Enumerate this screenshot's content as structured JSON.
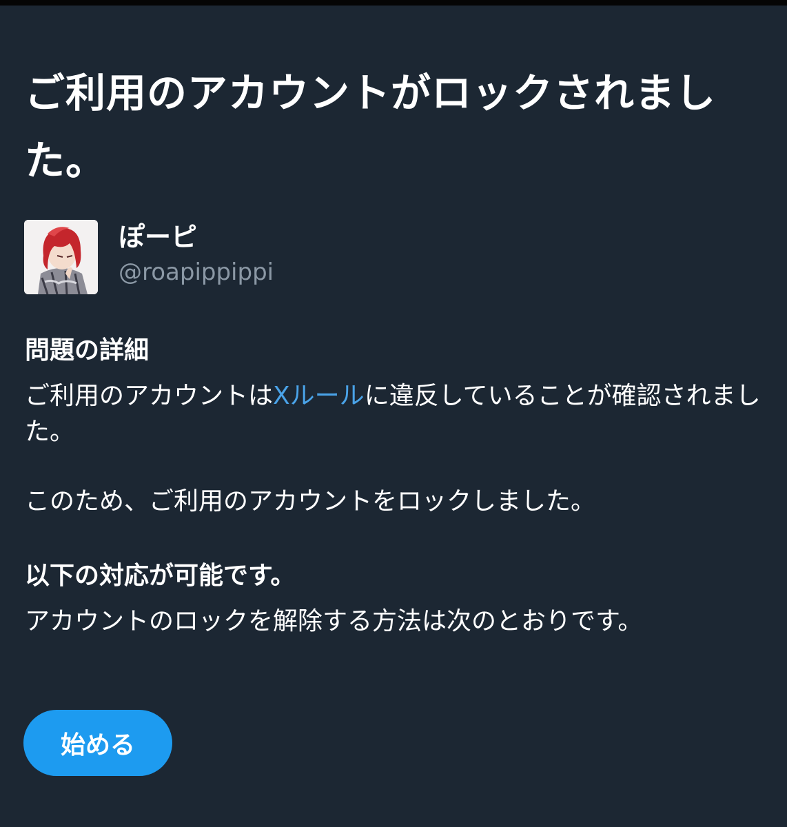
{
  "page": {
    "title": "ご利用のアカウントがロックされました。"
  },
  "account": {
    "display_name": "ぽーピ",
    "handle": "@roapippippi",
    "avatar_icon": "user-avatar-icon"
  },
  "details": {
    "heading": "問題の詳細",
    "violation_prefix": "ご利用のアカウントは",
    "rules_link": "Xルール",
    "violation_suffix": "に違反していることが確認されました。",
    "locked_statement": "このため、ご利用のアカウントをロックしました。"
  },
  "actions": {
    "heading": "以下の対応が可能です。",
    "description": "アカウントのロックを解除する方法は次のとおりです。",
    "start_button_label": "始める"
  },
  "colors": {
    "background": "#1c2733",
    "link": "#4aa3e8",
    "button": "#1d9bf0",
    "secondary_text": "#8b98a5"
  }
}
